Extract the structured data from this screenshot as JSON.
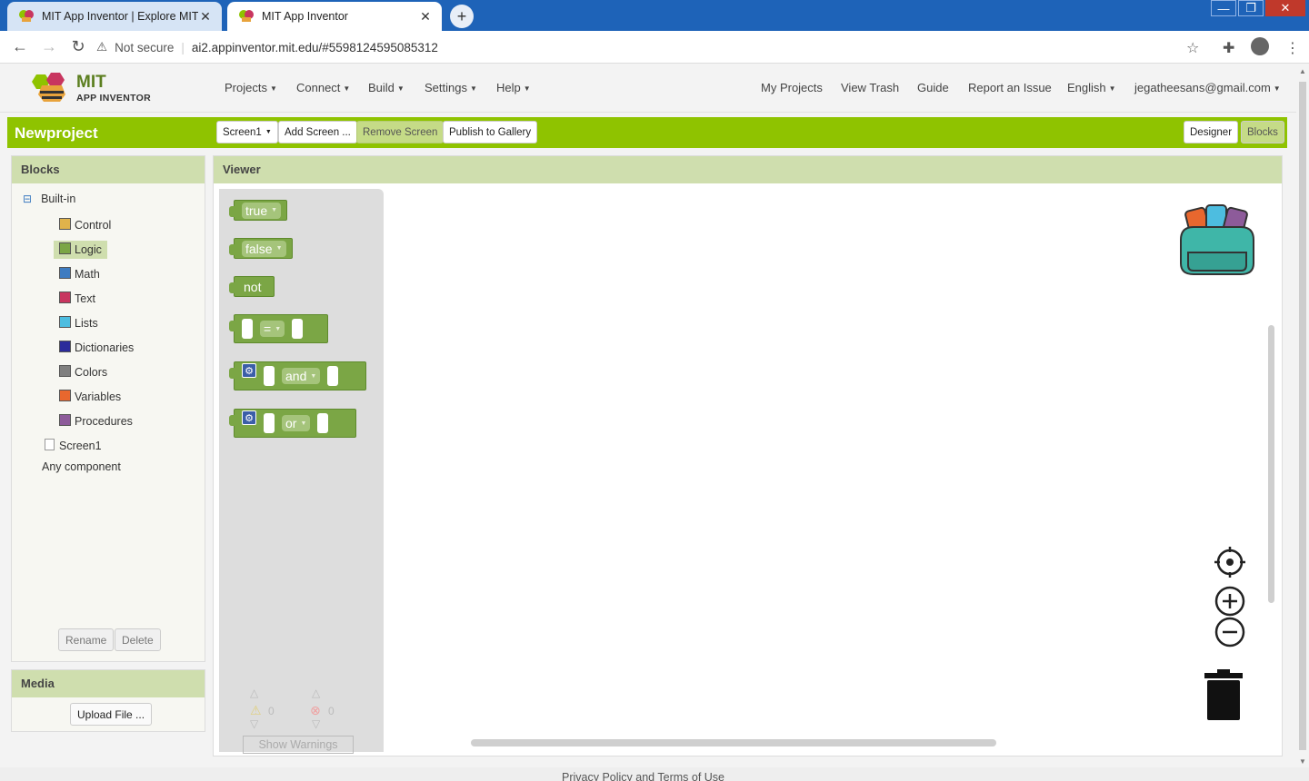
{
  "browser": {
    "tabs": [
      {
        "title": "MIT App Inventor | Explore MIT A",
        "active": false
      },
      {
        "title": "MIT App Inventor",
        "active": true
      }
    ],
    "security_label": "Not secure",
    "url": "ai2.appinventor.mit.edu/#5598124595085312"
  },
  "header": {
    "logo_line1": "MIT",
    "logo_line2": "APP INVENTOR",
    "menus": [
      "Projects",
      "Connect",
      "Build",
      "Settings",
      "Help"
    ],
    "links": [
      "My Projects",
      "View Trash",
      "Guide",
      "Report an Issue"
    ],
    "language": "English",
    "account": "jegatheesans@gmail.com"
  },
  "toolbar": {
    "project_name": "Newproject",
    "screen_select": "Screen1",
    "add_screen": "Add Screen ...",
    "remove_screen": "Remove Screen",
    "publish": "Publish to Gallery",
    "designer": "Designer",
    "blocks": "Blocks"
  },
  "blocks_panel": {
    "title": "Blocks",
    "builtin_label": "Built-in",
    "collapse_glyph": "⊟",
    "categories": [
      {
        "label": "Control",
        "color": "#e0b34b"
      },
      {
        "label": "Logic",
        "color": "#7ba645"
      },
      {
        "label": "Math",
        "color": "#3e7cc1"
      },
      {
        "label": "Text",
        "color": "#c8355f"
      },
      {
        "label": "Lists",
        "color": "#4dbde0"
      },
      {
        "label": "Dictionaries",
        "color": "#2b2b9b"
      },
      {
        "label": "Colors",
        "color": "#7f7f7f"
      },
      {
        "label": "Variables",
        "color": "#e8672e"
      },
      {
        "label": "Procedures",
        "color": "#8d5b9a"
      }
    ],
    "screen_item": "Screen1",
    "any_component": "Any component",
    "rename": "Rename",
    "delete": "Delete"
  },
  "media_panel": {
    "title": "Media",
    "upload": "Upload File ..."
  },
  "viewer": {
    "title": "Viewer",
    "blocks": {
      "true_label": "true",
      "false_label": "false",
      "not_label": "not",
      "eq_label": "=",
      "and_label": "and",
      "or_label": "or"
    },
    "warnings_count": "0",
    "errors_count": "0",
    "show_warnings": "Show Warnings"
  },
  "footer": {
    "text": "Privacy Policy and Terms of Use"
  }
}
